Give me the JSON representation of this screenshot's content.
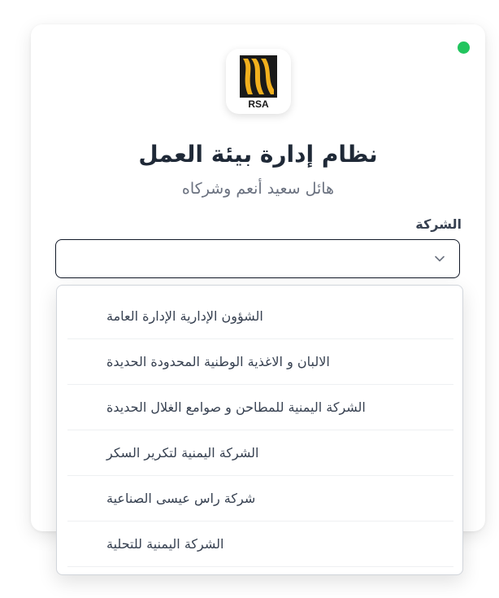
{
  "header": {
    "logo_alt": "RSA",
    "title": "نظام إدارة بيئة العمل",
    "subtitle": "هائل سعيد أنعم وشركاه",
    "status_color": "#22c55e"
  },
  "company_field": {
    "label": "الشركة",
    "value": ""
  },
  "dropdown": {
    "options": [
      {
        "label": "الشؤون الإدارية الإدارة العامة"
      },
      {
        "label": "الالبان و الاغذية الوطنية المحدودة الحديدة"
      },
      {
        "label": "الشركة اليمنية للمطاحن و صوامع الغلال الحديدة"
      },
      {
        "label": "الشركة اليمنية لتكرير السكر"
      },
      {
        "label": "شركة راس عيسى الصناعية"
      },
      {
        "label": "الشركة اليمنية للتحلية"
      }
    ]
  },
  "colors": {
    "accent_yellow": "#f2b01e",
    "logo_dark": "#1a1a1a"
  }
}
